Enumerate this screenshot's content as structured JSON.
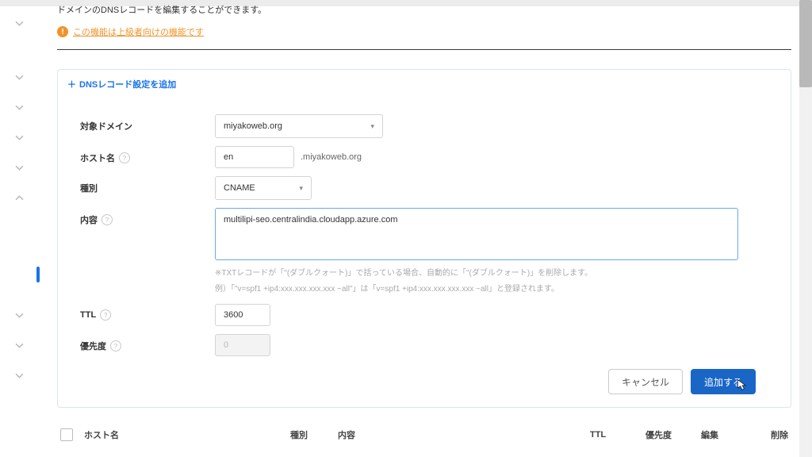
{
  "header": {
    "breadcrumb_fragment": "ドメインのDNSレコードを編集することができます。"
  },
  "warning": {
    "text": "この機能は上級者向けの機能です"
  },
  "panel": {
    "title": "DNSレコード設定を追加",
    "labels": {
      "domain": "対象ドメイン",
      "host": "ホスト名",
      "type": "種別",
      "content": "内容",
      "ttl": "TTL",
      "priority": "優先度"
    },
    "values": {
      "domain_selected": "miyakoweb.org",
      "host": "en",
      "host_suffix": ".miyakoweb.org",
      "type_selected": "CNAME",
      "content": "multilipi-seo.centralindia.cloudapp.azure.com",
      "ttl": "3600",
      "priority": "0"
    },
    "hints": {
      "line1": "※TXTレコードが「\"(ダブルクォート)」で括っている場合、自動的に「\"(ダブルクォート)」を削除します。",
      "line2": "例）「\"v=spf1 +ip4:xxx.xxx.xxx.xxx ~all\"」は「v=spf1 +ip4:xxx.xxx.xxx.xxx ~all」と登録されます。"
    },
    "buttons": {
      "cancel": "キャンセル",
      "submit": "追加する"
    }
  },
  "table": {
    "headers": {
      "host": "ホスト名",
      "type": "種別",
      "content": "内容",
      "ttl": "TTL",
      "priority": "優先度",
      "edit": "編集",
      "delete": "削除"
    }
  }
}
